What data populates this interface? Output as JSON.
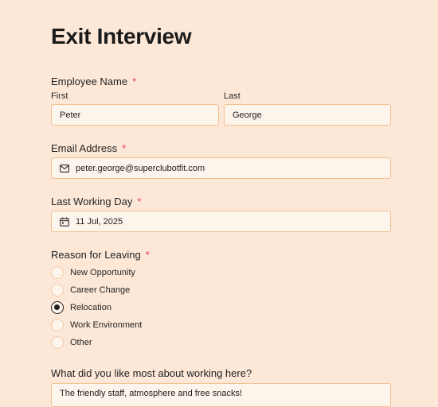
{
  "form": {
    "title": "Exit Interview",
    "required_mark": "*",
    "employee_name": {
      "label": "Employee Name",
      "first_label": "First",
      "last_label": "Last",
      "first_value": "Peter",
      "last_value": "George"
    },
    "email": {
      "label": "Email Address",
      "value": "peter.george@superclubotfit.com"
    },
    "last_working_day": {
      "label": "Last Working Day",
      "value": "11 Jul, 2025"
    },
    "reason": {
      "label": "Reason for Leaving",
      "options": [
        "New Opportunity",
        "Career Change",
        "Relocation",
        "Work Environment",
        "Other"
      ],
      "selected": "Relocation"
    },
    "liked_most": {
      "label": "What did you like most about working here?",
      "value": "The friendly staff, atmosphere and free snacks!"
    }
  },
  "colors": {
    "background": "#fde8d8",
    "input_border": "#f0c090",
    "required": "#e03b5a"
  }
}
